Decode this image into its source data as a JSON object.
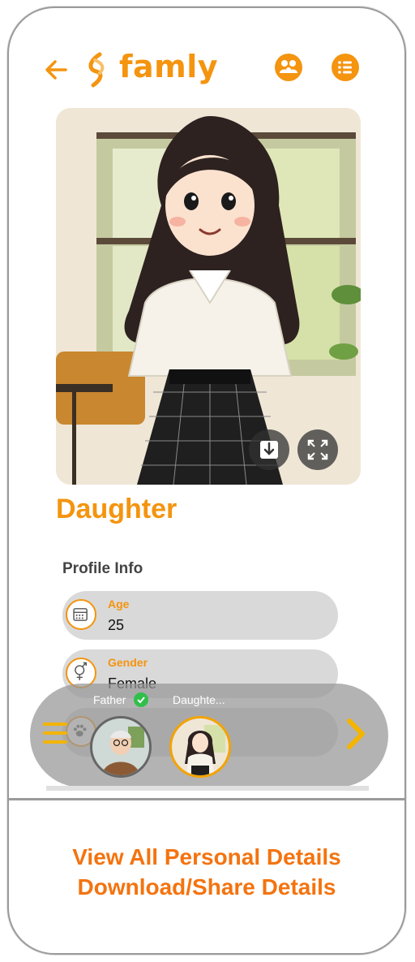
{
  "header": {
    "brand": "famly",
    "back_icon": "arrow-left-icon",
    "family_icon": "family-group-icon",
    "menu_icon": "list-menu-icon",
    "accent": "#f4940f"
  },
  "photo": {
    "download_icon": "download-icon",
    "expand_icon": "expand-icon"
  },
  "profile": {
    "title": "Daughter",
    "section": "Profile Info",
    "fields": [
      {
        "label": "Age",
        "value": "25",
        "icon": "calendar-icon"
      },
      {
        "label": "Gender",
        "value": "Female",
        "icon": "gender-icon"
      },
      {
        "icon": "paw-icon"
      }
    ]
  },
  "carousel": {
    "members": [
      {
        "label": "Father",
        "verified": true
      },
      {
        "label": "Daughte..."
      }
    ],
    "menu_icon": "hamburger-icon",
    "next_icon": "chevron-right-icon"
  },
  "promo": {
    "line1": "View All Personal Details",
    "line2": "Download/Share Details",
    "color": "#f4730f"
  }
}
